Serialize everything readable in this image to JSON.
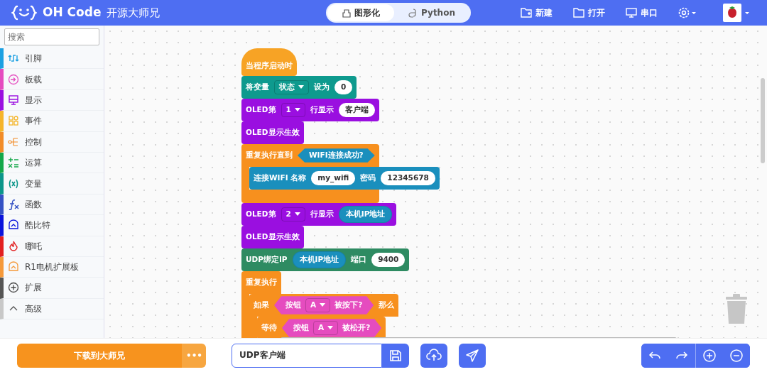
{
  "header": {
    "brand": "OH Code",
    "subtitle": "开源大师兄",
    "mode_tabs": [
      {
        "label": "图形化",
        "selected": true
      },
      {
        "label": "Python",
        "selected": false
      }
    ],
    "actions": [
      {
        "label": "新建"
      },
      {
        "label": "打开"
      },
      {
        "label": "串口"
      }
    ]
  },
  "sidebar": {
    "search": {
      "placeholder": "搜索"
    },
    "items": [
      {
        "label": "引脚",
        "color": "#1ba0e2"
      },
      {
        "label": "板载",
        "color": "#e54cbf"
      },
      {
        "label": "显示",
        "color": "#9a0fe0"
      },
      {
        "label": "事件",
        "color": "#f5b52a"
      },
      {
        "label": "控制",
        "color": "#f28c28"
      },
      {
        "label": "运算",
        "color": "#14a84a"
      },
      {
        "label": "变量",
        "color": "#0b968a"
      },
      {
        "label": "函数",
        "color": "#3552c4"
      },
      {
        "label": "酷比特",
        "color": "#0a14dc"
      },
      {
        "label": "哪吒",
        "color": "#e21f1f"
      },
      {
        "label": "R1电机扩展板",
        "color": "#f5993a"
      },
      {
        "label": "扩展",
        "color": "#555555"
      },
      {
        "label": "高级",
        "color": "#c8c8c8"
      }
    ]
  },
  "workspace": {
    "blocks": [
      {
        "kind": "hat",
        "color": "#f7a325",
        "parts": [
          {
            "kind": "label",
            "text": "当程序启动时"
          }
        ]
      },
      {
        "kind": "statement",
        "color": "#0e9a8e",
        "parts": [
          {
            "kind": "label",
            "text": "将变量"
          },
          {
            "kind": "dropdown",
            "text": "状态"
          },
          {
            "kind": "label",
            "text": "设为"
          },
          {
            "kind": "input",
            "text": "0"
          }
        ]
      },
      {
        "kind": "statement",
        "color": "#9a0fe0",
        "parts": [
          {
            "kind": "label",
            "text": "OLED第"
          },
          {
            "kind": "dropdown",
            "text": "1"
          },
          {
            "kind": "label",
            "text": "行显示"
          },
          {
            "kind": "input",
            "text": "客户端"
          }
        ]
      },
      {
        "kind": "statement",
        "color": "#9a0fe0",
        "parts": [
          {
            "kind": "label",
            "text": "OLED显示生效"
          }
        ]
      },
      {
        "kind": "c_block",
        "color": "#f7901e",
        "parts": [
          {
            "kind": "label",
            "text": "重复执行直到"
          },
          {
            "kind": "boolean",
            "text": "WIFI连接成功?",
            "color": "#1a8fbd"
          }
        ],
        "children": [
          {
            "kind": "statement",
            "color": "#1a8fbd",
            "parts": [
              {
                "kind": "label",
                "text": "连接WIFI 名称"
              },
              {
                "kind": "input",
                "text": "my_wifi"
              },
              {
                "kind": "label",
                "text": "密码"
              },
              {
                "kind": "input",
                "text": "12345678"
              }
            ]
          }
        ]
      },
      {
        "kind": "statement",
        "color": "#9a0fe0",
        "parts": [
          {
            "kind": "label",
            "text": "OLED第"
          },
          {
            "kind": "dropdown",
            "text": "2"
          },
          {
            "kind": "label",
            "text": "行显示"
          },
          {
            "kind": "reporter",
            "text": "本机IP地址",
            "color": "#1a8fbd"
          }
        ]
      },
      {
        "kind": "statement",
        "color": "#9a0fe0",
        "parts": [
          {
            "kind": "label",
            "text": "OLED显示生效"
          }
        ]
      },
      {
        "kind": "statement",
        "color": "#2e8b62",
        "parts": [
          {
            "kind": "label",
            "text": "UDP绑定IP"
          },
          {
            "kind": "reporter",
            "text": "本机IP地址",
            "color": "#1a8fbd"
          },
          {
            "kind": "label",
            "text": "端口"
          },
          {
            "kind": "input",
            "text": "9400"
          }
        ]
      },
      {
        "kind": "c_block",
        "color": "#f7901e",
        "parts": [
          {
            "kind": "label",
            "text": "重复执行"
          }
        ],
        "children": [
          {
            "kind": "c_block",
            "color": "#f7901e",
            "parts": [
              {
                "kind": "label",
                "text": "如果"
              },
              {
                "kind": "boolean",
                "color": "#e54cbf",
                "parts": [
                  {
                    "kind": "label",
                    "text": "按钮"
                  },
                  {
                    "kind": "dropdown",
                    "text": "A"
                  },
                  {
                    "kind": "label",
                    "text": "被按下?"
                  }
                ]
              },
              {
                "kind": "label",
                "text": "那么"
              }
            ],
            "children": [
              {
                "kind": "statement",
                "color": "#f7901e",
                "parts": [
                  {
                    "kind": "label",
                    "text": "等待"
                  },
                  {
                    "kind": "boolean",
                    "color": "#e54cbf",
                    "parts": [
                      {
                        "kind": "label",
                        "text": "按钮"
                      },
                      {
                        "kind": "dropdown",
                        "text": "A"
                      },
                      {
                        "kind": "label",
                        "text": "被松开?"
                      }
                    ]
                  }
                ]
              }
            ]
          }
        ]
      }
    ]
  },
  "footer": {
    "download_button": "下载到大师兄",
    "more_button": "•••",
    "project_name": "UDP客户端"
  }
}
